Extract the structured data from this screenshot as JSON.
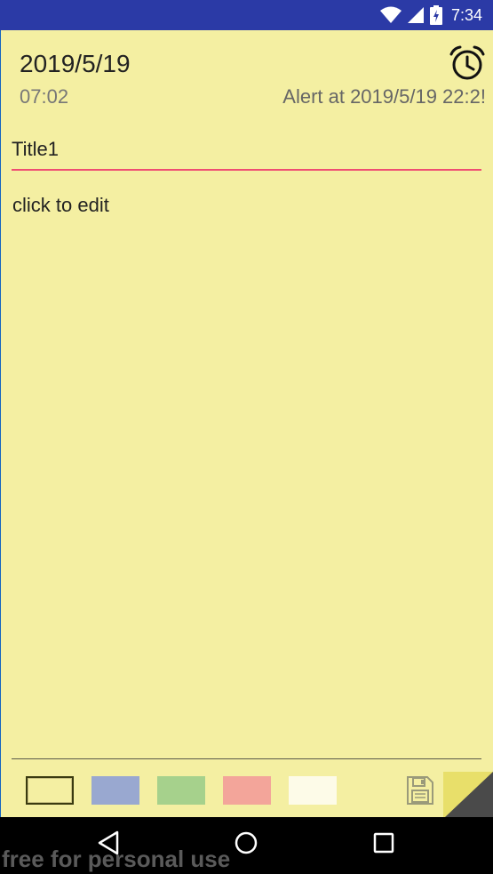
{
  "status_bar": {
    "time": "7:34",
    "icons": [
      "wifi-icon",
      "signal-icon",
      "battery-icon"
    ]
  },
  "note": {
    "date": "2019/5/19",
    "time": "07:02",
    "alert_text": "Alert at 2019/5/19 22:2!",
    "title_value": "Title1",
    "body_text": "click to edit"
  },
  "palette": {
    "colors": [
      "#f4efa2",
      "#99a8d0",
      "#a6d18c",
      "#f3a59a",
      "#fdfbe8"
    ],
    "selected": "#f4efa2"
  },
  "accent": "#ef4d73",
  "watermark": "free for personal use"
}
